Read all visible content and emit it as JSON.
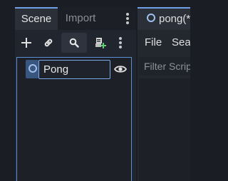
{
  "scene_dock": {
    "tabs": [
      {
        "label": "Scene",
        "active": true
      },
      {
        "label": "Import",
        "active": false
      }
    ],
    "toolbar": {
      "add_node_icon": "plus-icon",
      "link_icon": "link-icon",
      "search_icon": "search-icon",
      "script_icon": "attach-script-icon",
      "menu_icon": "vertical-dots-icon"
    },
    "tree": {
      "root_node": {
        "name_input_value": "Pong",
        "icon": "node2d-circle-icon",
        "visibility_icon": "eye-icon"
      }
    }
  },
  "script_editor": {
    "tab_label": "pong(*",
    "menu": [
      {
        "label": "File"
      },
      {
        "label": "Sear"
      }
    ],
    "filter_placeholder": "Filter Scrip"
  },
  "colors": {
    "accent": "#6fa0e5",
    "background": "#1a1d24",
    "panel": "#21252d",
    "node_icon": "#9ec1ee"
  }
}
